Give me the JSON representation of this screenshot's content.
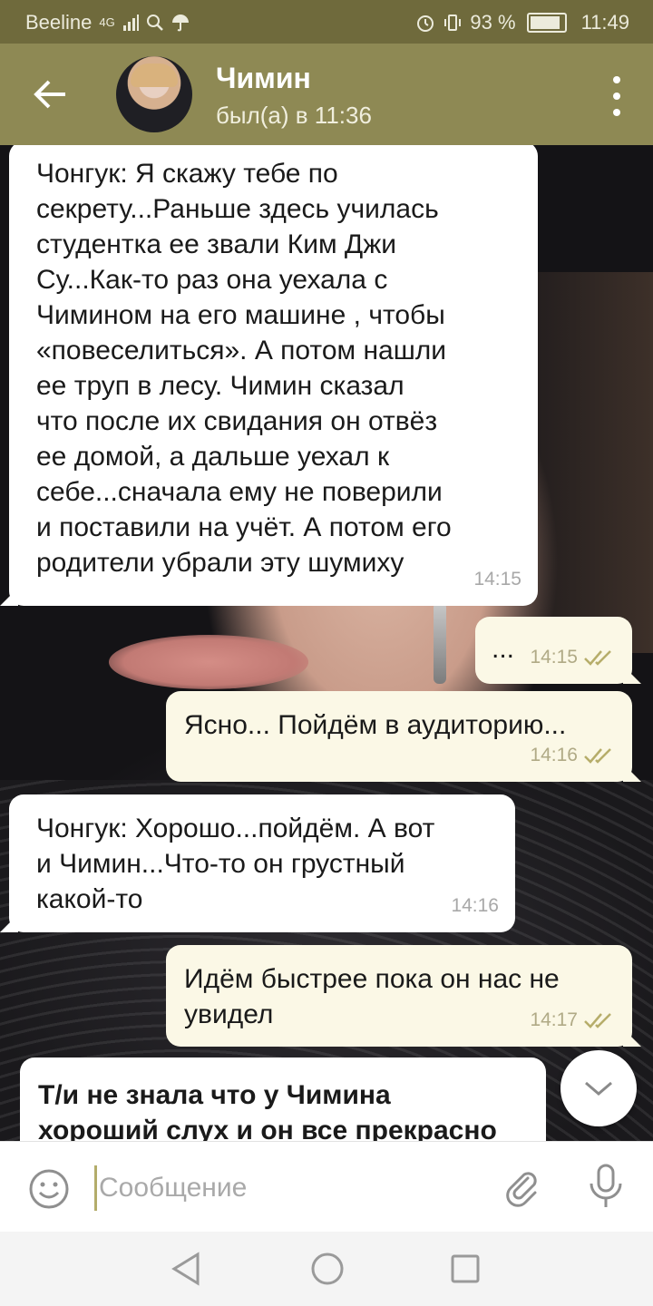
{
  "status_bar": {
    "carrier": "Beeline",
    "network": "4G",
    "battery_percent": "93 %",
    "time": "11:49"
  },
  "header": {
    "contact_name": "Чимин",
    "last_seen": "был(а) в 11:36",
    "icons": {
      "back": "arrow-left-icon",
      "menu": "more-vertical-icon"
    }
  },
  "messages": [
    {
      "direction": "in",
      "text": "Чонгук: Я скажу тебе по\nсекрету...Раньше здесь училась\nстудентка ее звали Ким Джи\nСу...Как-то раз она уехала с\nЧимином на его машине , чтобы\n«повеселиться». А потом нашли\nее труп в лесу. Чимин сказал\nчто после их свидания он отвёз\nее домой, а дальше уехал к\nсебе...сначала ему не поверили\nи поставили на учёт. А потом его\nродители убрали эту шумиху",
      "time": "14:15"
    },
    {
      "direction": "out",
      "text": "...",
      "time": "14:15",
      "read": true
    },
    {
      "direction": "out",
      "text": "Ясно... Пойдём в аудиторию...",
      "time": "14:16",
      "read": true
    },
    {
      "direction": "in",
      "text": "Чонгук: Хорошо...пойдём. А вот\nи Чимин...Что-то он грустный\nкакой-то",
      "time": "14:16"
    },
    {
      "direction": "out",
      "text": "Идём быстрее пока он нас не\nувидел",
      "time": "14:17",
      "read": true
    },
    {
      "direction": "in",
      "text": "Т/и не знала что у Чимина\nхороший слух и он все прекрасно",
      "time": ""
    }
  ],
  "input": {
    "placeholder": "Сообщение",
    "icons": {
      "emoji": "smile-icon",
      "attach": "paperclip-icon",
      "mic": "microphone-icon"
    }
  },
  "colors": {
    "header": "#8e8954",
    "status_bar": "#6f6a3c",
    "outgoing_bubble": "#fbf8e6",
    "incoming_bubble": "#ffffff",
    "read_ticks": "#b6ad6a"
  }
}
